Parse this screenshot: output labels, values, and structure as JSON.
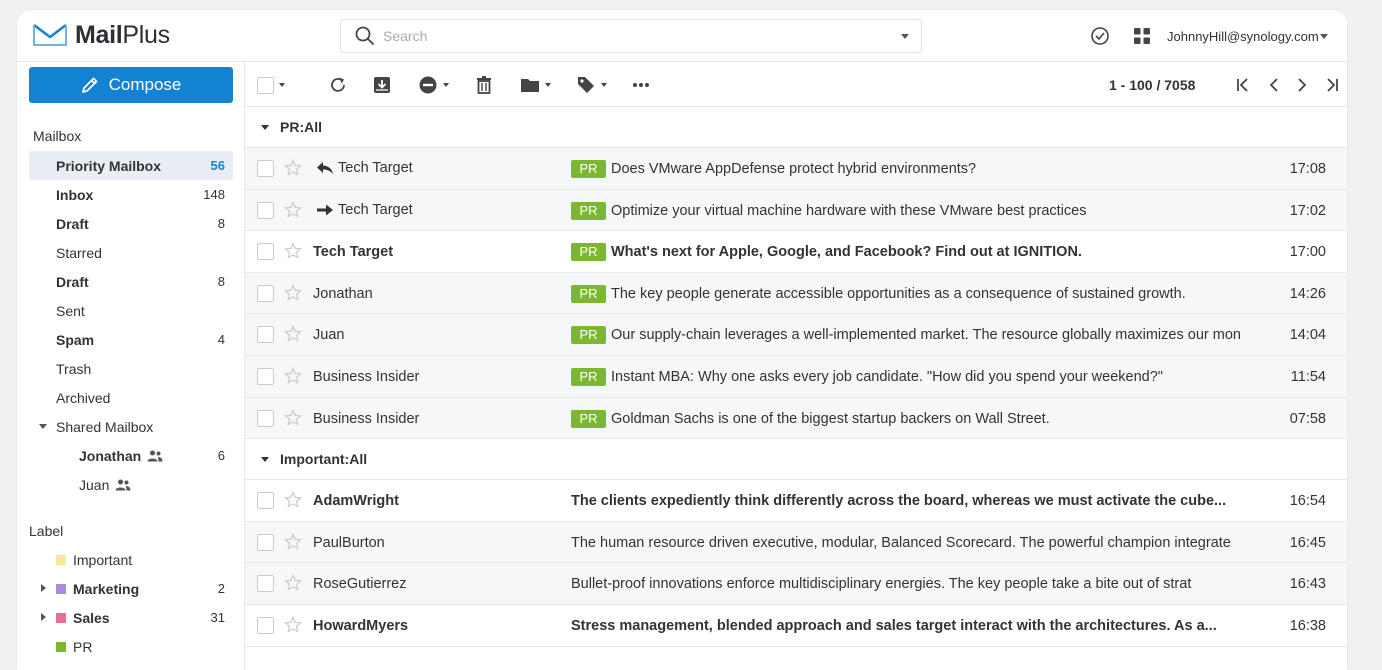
{
  "app": {
    "brand_main": "Mail",
    "brand_sub": "Plus"
  },
  "search": {
    "placeholder": "Search"
  },
  "header": {
    "user": "JohnnyHill@synology.com"
  },
  "sidebar": {
    "compose_label": "Compose",
    "mailbox_title": "Mailbox",
    "items": [
      {
        "label": "Priority Mailbox",
        "count": "56"
      },
      {
        "label": "Inbox",
        "count": "148"
      },
      {
        "label": "Draft",
        "count": "8"
      },
      {
        "label": "Starred",
        "count": ""
      },
      {
        "label": "Draft",
        "count": "8"
      },
      {
        "label": "Sent",
        "count": ""
      },
      {
        "label": "Spam",
        "count": "4"
      },
      {
        "label": "Trash",
        "count": ""
      },
      {
        "label": "Archived",
        "count": ""
      }
    ],
    "shared": {
      "label": "Shared Mailbox",
      "items": [
        {
          "label": "Jonathan",
          "count": "6"
        },
        {
          "label": "Juan",
          "count": ""
        }
      ]
    },
    "label_title": "Label",
    "labels": [
      {
        "label": "Important",
        "count": "",
        "color": "#fbe79a"
      },
      {
        "label": "Marketing",
        "count": "2",
        "color": "#a78bde"
      },
      {
        "label": "Sales",
        "count": "31",
        "color": "#ec6b8e"
      },
      {
        "label": "PR",
        "count": "",
        "color": "#7cb82f"
      }
    ]
  },
  "toolbar": {
    "paging": "1 - 100 / 7058"
  },
  "groups": [
    {
      "title": "PR:All",
      "rows": [
        {
          "sender": "Tech Target",
          "tag": "PR",
          "subject": "Does VMware AppDefense protect hybrid environments?",
          "time": "17:08"
        },
        {
          "sender": "Tech Target",
          "tag": "PR",
          "subject": "Optimize your virtual machine hardware with these VMware best practices",
          "time": "17:02"
        },
        {
          "sender": "Tech Target",
          "tag": "PR",
          "subject": "What's next for Apple, Google, and Facebook? Find out at IGNITION.",
          "time": "17:00"
        },
        {
          "sender": "Jonathan",
          "tag": "PR",
          "subject": "The key people generate accessible opportunities as a consequence of sustained growth.",
          "time": "14:26"
        },
        {
          "sender": "Juan",
          "tag": "PR",
          "subject": "Our supply-chain leverages a well-implemented market. The resource globally maximizes our mon",
          "time": "14:04"
        },
        {
          "sender": "Business Insider",
          "tag": "PR",
          "subject": "Instant MBA: Why one asks every job candidate. \"How did you spend your weekend?\"",
          "time": "11:54"
        },
        {
          "sender": "Business Insider",
          "tag": "PR",
          "subject": "Goldman Sachs is one of the biggest startup backers on Wall Street.",
          "time": "07:58"
        }
      ]
    },
    {
      "title": "Important:All",
      "rows": [
        {
          "sender": "AdamWright",
          "subject": "The clients expediently think differently across the board, whereas we must activate the cube...",
          "time": "16:54"
        },
        {
          "sender": "PaulBurton",
          "subject": "The human resource driven executive, modular, Balanced Scorecard. The powerful champion integrate",
          "time": "16:45"
        },
        {
          "sender": "RoseGutierrez",
          "subject": "Bullet-proof innovations enforce multidisciplinary energies. The key people take a bite out of strat",
          "time": "16:43"
        },
        {
          "sender": "HowardMyers",
          "subject": "Stress management, blended approach and sales target interact with the architectures. As a...",
          "time": "16:38"
        }
      ]
    }
  ],
  "colors": {
    "accent": "#1482d2",
    "pr_tag": "#7cb82f"
  }
}
